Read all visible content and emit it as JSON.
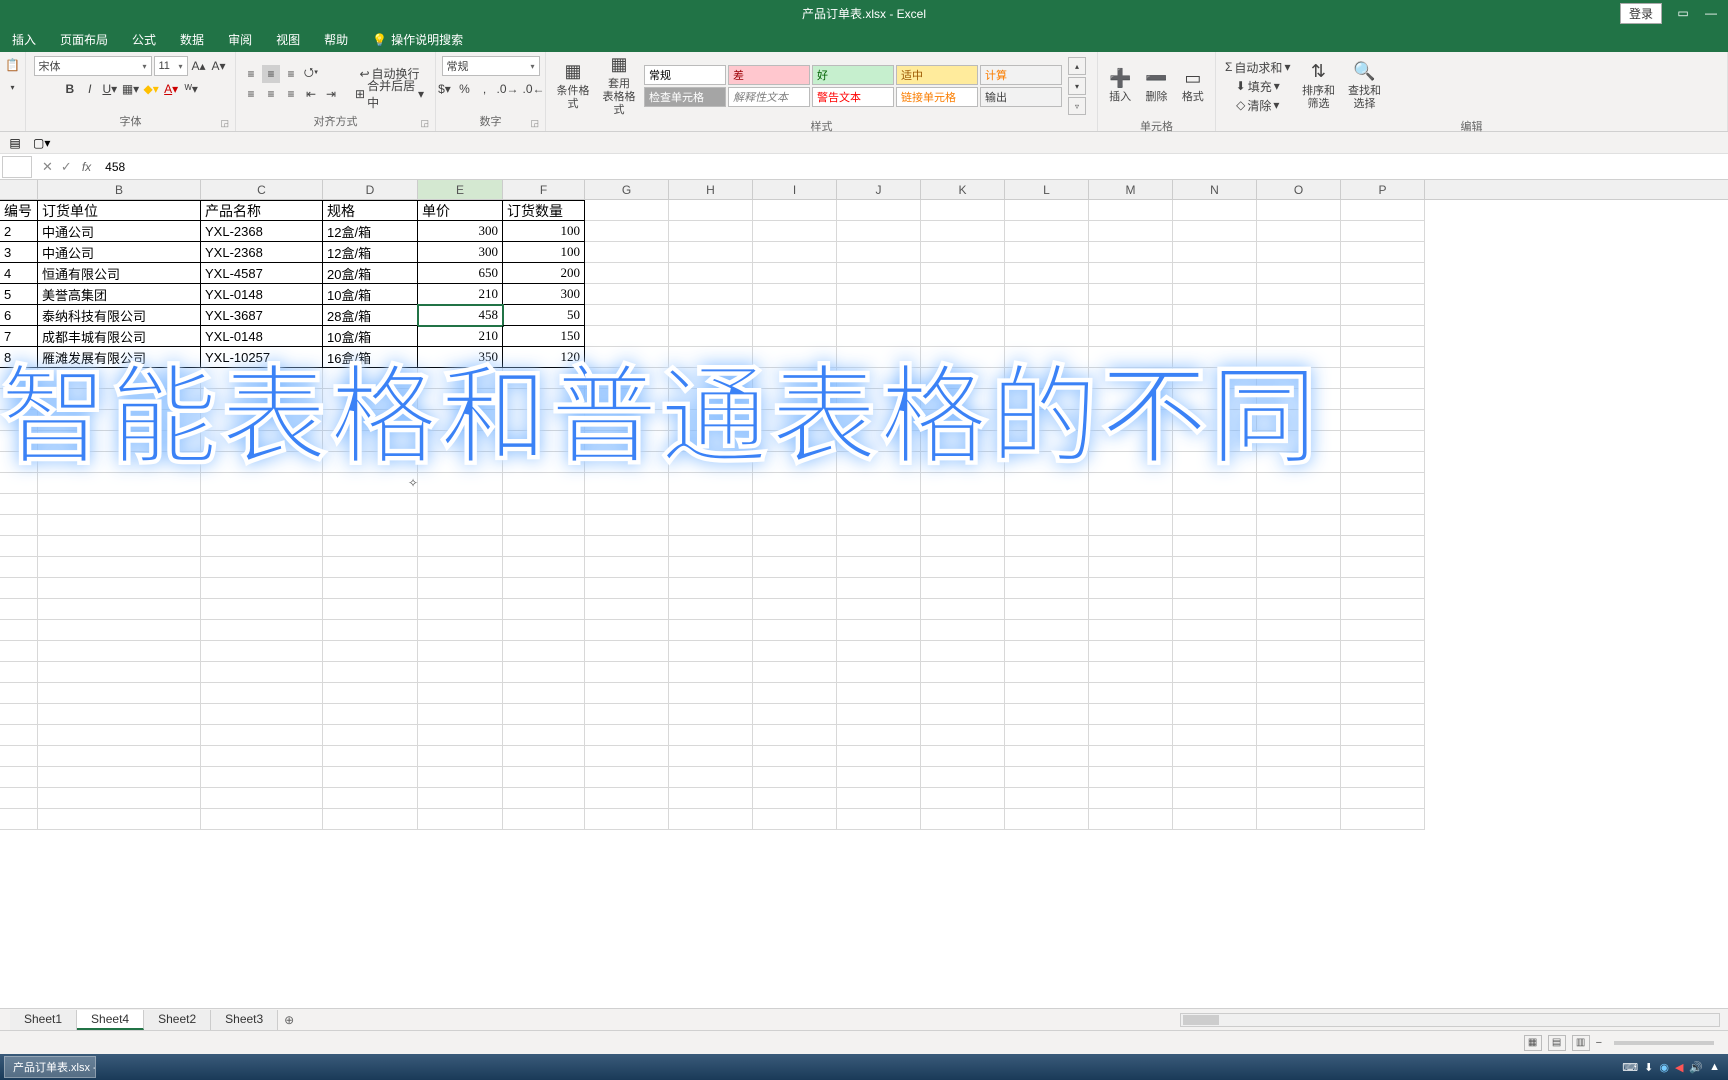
{
  "app": {
    "title": "产品订单表.xlsx - Excel",
    "login": "登录"
  },
  "menu_tabs": [
    "插入",
    "页面布局",
    "公式",
    "数据",
    "审阅",
    "视图",
    "帮助"
  ],
  "tell_me": "操作说明搜索",
  "ribbon": {
    "font": {
      "name": "宋体",
      "size": "11",
      "group": "字体"
    },
    "align": {
      "wrap": "自动换行",
      "merge": "合并后居中",
      "group": "对齐方式"
    },
    "number": {
      "format": "常规",
      "group": "数字"
    },
    "styles": {
      "cond": "条件格式",
      "table": "套用\n表格格式",
      "cells": [
        {
          "t": "常规",
          "bg": "#ffffff",
          "c": "#000"
        },
        {
          "t": "差",
          "bg": "#ffc7ce",
          "c": "#9c0006"
        },
        {
          "t": "好",
          "bg": "#c6efce",
          "c": "#006100"
        },
        {
          "t": "适中",
          "bg": "#ffeb9c",
          "c": "#9c5700"
        },
        {
          "t": "计算",
          "bg": "#f2f2f2",
          "c": "#fa7d00"
        },
        {
          "t": "检查单元格",
          "bg": "#a5a5a5",
          "c": "#fff"
        },
        {
          "t": "解释性文本",
          "bg": "#fff",
          "c": "#7f7f7f"
        },
        {
          "t": "警告文本",
          "bg": "#fff",
          "c": "#ff0000"
        },
        {
          "t": "链接单元格",
          "bg": "#fff",
          "c": "#fa7d00"
        },
        {
          "t": "输出",
          "bg": "#f2f2f2",
          "c": "#3f3f3f"
        }
      ],
      "group": "样式"
    },
    "cells": {
      "insert": "插入",
      "delete": "删除",
      "format": "格式",
      "group": "单元格"
    },
    "editing": {
      "sum": "自动求和",
      "fill": "填充",
      "clear": "清除",
      "sort": "排序和筛选",
      "find": "查找和选择",
      "group": "编辑"
    }
  },
  "formula": {
    "value": "458"
  },
  "columns": [
    "",
    "B",
    "C",
    "D",
    "E",
    "F",
    "G",
    "H",
    "I",
    "J",
    "K",
    "L",
    "M",
    "N",
    "O",
    "P"
  ],
  "col_widths": [
    "wA",
    "wB",
    "wC",
    "wD",
    "wE",
    "wF",
    "wS",
    "wS",
    "wS",
    "wS",
    "wS",
    "wS",
    "wS",
    "wS",
    "wS",
    "wS"
  ],
  "headers": [
    "编号",
    "订货单位",
    "产品名称",
    "规格",
    "单价",
    "订货数量"
  ],
  "rows": [
    {
      "a": "2",
      "b": "中通公司",
      "c": "YXL-2368",
      "d": "12盒/箱",
      "e": "300",
      "f": "100"
    },
    {
      "a": "3",
      "b": "中通公司",
      "c": "YXL-2368",
      "d": "12盒/箱",
      "e": "300",
      "f": "100"
    },
    {
      "a": "4",
      "b": "恒通有限公司",
      "c": "YXL-4587",
      "d": "20盒/箱",
      "e": "650",
      "f": "200"
    },
    {
      "a": "5",
      "b": "美誉高集团",
      "c": "YXL-0148",
      "d": "10盒/箱",
      "e": "210",
      "f": "300"
    },
    {
      "a": "6",
      "b": "泰纳科技有限公司",
      "c": "YXL-3687",
      "d": "28盒/箱",
      "e": "458",
      "f": "50"
    },
    {
      "a": "7",
      "b": "成都丰城有限公司",
      "c": "YXL-0148",
      "d": "10盒/箱",
      "e": "210",
      "f": "150"
    },
    {
      "a": "8",
      "b": "雁滩发展有限公司",
      "c": "YXL-10257",
      "d": "16盒/箱",
      "e": "350",
      "f": "120"
    }
  ],
  "overlay_text": "智能表格和普通表格的不同",
  "sheets": [
    "Sheet1",
    "Sheet4",
    "Sheet2",
    "Sheet3"
  ],
  "active_sheet": "Sheet4",
  "taskbar": {
    "task": "产品订单表.xlsx - ..."
  }
}
